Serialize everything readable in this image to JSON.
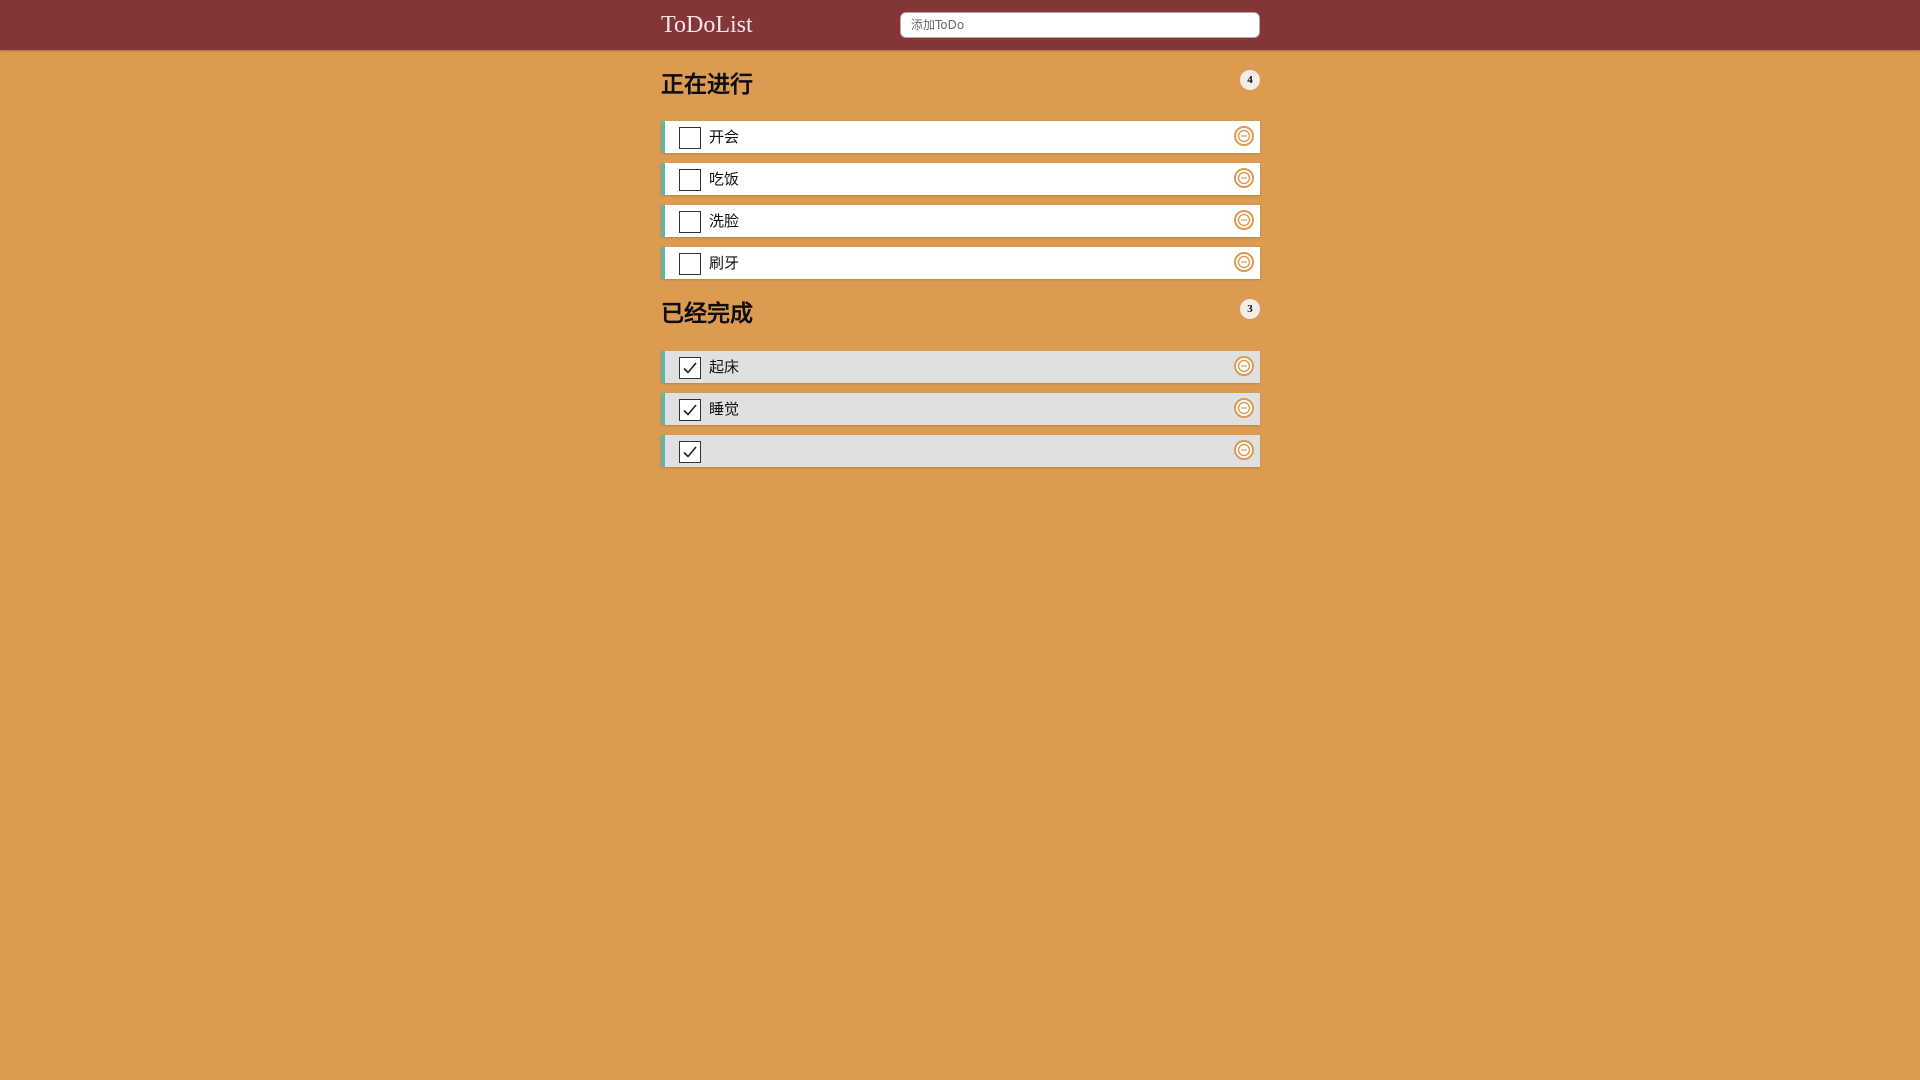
{
  "header": {
    "title": "ToDoList",
    "add_placeholder": "添加ToDo"
  },
  "sections": {
    "active": {
      "title": "正在进行",
      "count": "4",
      "items": [
        {
          "text": "开会",
          "done": false
        },
        {
          "text": "吃饭",
          "done": false
        },
        {
          "text": "洗脸",
          "done": false
        },
        {
          "text": "刷牙",
          "done": false
        }
      ]
    },
    "completed": {
      "title": "已经完成",
      "count": "3",
      "items": [
        {
          "text": "起床",
          "done": true
        },
        {
          "text": "睡觉",
          "done": true
        },
        {
          "text": "",
          "done": true
        }
      ]
    }
  },
  "icons": {
    "checkbox": "checkbox-icon",
    "checkmark": "checkmark-icon",
    "remove": "remove-circle-icon"
  },
  "colors": {
    "background": "#dd9b51",
    "header": "#843538",
    "item_accent": "#63b4a8",
    "remove_icon": "#dd9b51",
    "done_item_bg": "#e0e0e0"
  }
}
